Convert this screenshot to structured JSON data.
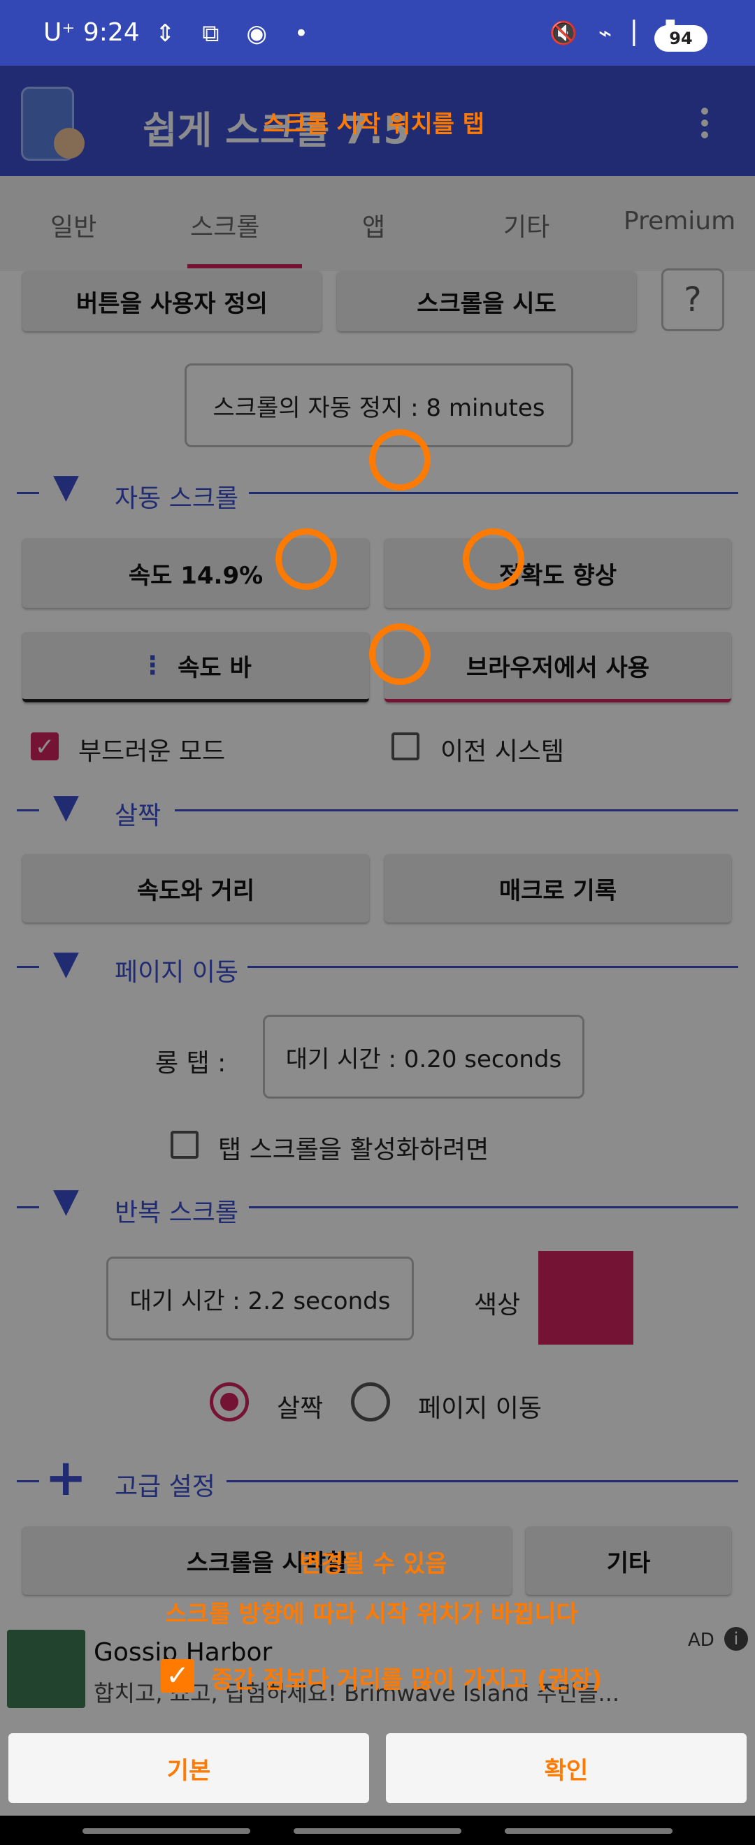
{
  "status_bar": {
    "carrier": "U⁺",
    "time": "9:24",
    "left_icons": "⇕ ⧉ ◉ •",
    "right_icons": "🔇 ⌁ ▏▐",
    "battery": "94"
  },
  "app_bar": {
    "title": "쉽게 스크롤 7.5",
    "app_icon": "scroll-hand-icon",
    "menu_icon": "overflow-menu-icon"
  },
  "tabs": [
    {
      "label": "일반"
    },
    {
      "label": "스크롤"
    },
    {
      "label": "앱"
    },
    {
      "label": "기타"
    },
    {
      "label": "Premium"
    }
  ],
  "top_buttons": {
    "customize": "버튼을 사용자 정의",
    "try_scroll": "스크롤을 시도",
    "help": "?"
  },
  "auto_stop": "스크롤의 자동 정지 : 8 minutes",
  "sections": {
    "auto_scroll": "자동 스크롤",
    "slight": "살짝",
    "page_move": "페이지 이동",
    "repeat_scroll": "반복 스크롤",
    "advanced": "고급 설정"
  },
  "auto_scroll": {
    "speed": "속도 14.9%",
    "accuracy": "정확도 향상",
    "speed_bar": "속도 바",
    "use_in_browser": "브라우저에서 사용",
    "smooth_mode": "부드러운 모드",
    "legacy_system": "이전 시스템"
  },
  "slight": {
    "speed_distance": "속도와 거리",
    "macro_record": "매크로 기록"
  },
  "page_move": {
    "long_tap_label": "롱 탭 :",
    "wait_time": "대기 시간 : 0.20 seconds",
    "tap_scroll": "탭 스크롤을 활성화하려면"
  },
  "repeat_scroll": {
    "wait_time": "대기 시간 : 2.2 seconds",
    "color_label": "색상",
    "color_value": "#d6245f",
    "radio_slight": "살짝",
    "radio_page": "페이지 이동"
  },
  "advanced": {
    "start_scroll": "스크롤을 시작할",
    "other": "기타"
  },
  "overlay": {
    "hint_top": "스크롤 시작 위치를 탭",
    "hint_change": "변경될 수 있음",
    "hint_direction": "스크롤 방향에 따라 시작 위치가 바뀝니다",
    "hint_distance": "중간 점보다 거리를 많이 가지고 (권장)",
    "default_button": "기본",
    "confirm_button": "확인"
  },
  "ad": {
    "title": "Gossip Harbor",
    "desc": "합치고, 쇼고, 답험하세요! Brimwave Island 주민들...",
    "badge": "AD",
    "info": "i"
  },
  "colors": {
    "accent": "#d6245f",
    "primary": "#3b4fcf",
    "hint": "#ff7a00"
  }
}
